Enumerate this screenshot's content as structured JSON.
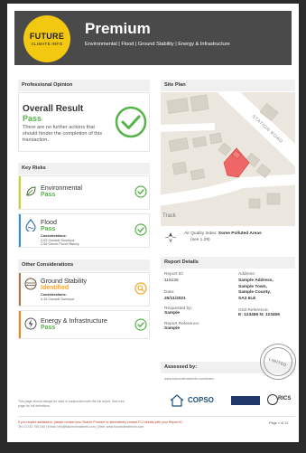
{
  "header": {
    "logo_line1": "FUTURE",
    "logo_line2": "CLIMATE INFO",
    "title": "Premium",
    "subtitle": "Environmental | Flood | Ground Stability | Energy & Infrastructure"
  },
  "professional_opinion": {
    "heading": "Professional Opinion",
    "result_title": "Overall Result",
    "result_value": "Pass",
    "description": "There are no further actions that should hinder the completion of this transaction."
  },
  "key_risks": {
    "heading": "Key Risks",
    "items": [
      {
        "name": "Environmental",
        "value": "Pass"
      },
      {
        "name": "Flood",
        "value": "Pass",
        "considerations_label": "Considerations:",
        "considerations": [
          "2.03 Consult Surveyor",
          "2.06 Check Flood History"
        ]
      }
    ]
  },
  "other_considerations": {
    "heading": "Other Considerations",
    "items": [
      {
        "name": "Ground Stability",
        "value": "Identified",
        "considerations_label": "Considerations:",
        "considerations": [
          "3.15 Consult Surveyor"
        ]
      },
      {
        "name": "Energy & Infrastructure",
        "value": "Pass"
      }
    ]
  },
  "site_plan": {
    "heading": "Site Plan",
    "road_label": "STATION ROAD",
    "track_label": "Track",
    "aqi_label": "Air Quality Index:",
    "aqi_value": "Some Polluted Areas",
    "aqi_sub": "(see 1.29)",
    "compass": "N"
  },
  "report_details": {
    "heading": "Report Details",
    "report_id_label": "Report ID:",
    "report_id": "115125",
    "date_label": "Date:",
    "date": "25/11/2021",
    "requested_label": "Requested by:",
    "requested": "Sample",
    "reference_label": "Report Reference:",
    "reference": "Sample",
    "address_label": "Address:",
    "address": [
      "Sample Address,",
      "Sample Town,",
      "Sample County,",
      "SA3 6LE"
    ],
    "grid_label": "Grid Reference:",
    "grid": "E: 123456 N: 123456"
  },
  "assessed": {
    "label": "Assessed by:",
    "url": "www.futureclimateinfo.com/team",
    "stamp": "LIMITED"
  },
  "footer": {
    "note": "This page should always be read in conjunction with the full report. See next page for full definitions.",
    "partners": [
      "COPSO",
      "RICS"
    ],
    "help": "If you require assistance, please contact your Search Provider or alternatively contact FCI directly with your Report ID.",
    "contact": "Tel: 01732 755 180 | Email: info@futureclimateinfo.com | Web: www.futureclimateinfo.com",
    "page": "Page 1 of 12"
  },
  "colors": {
    "pass": "#55b447",
    "warn": "#f5a623",
    "header_bg": "#4a4a4a",
    "logo": "#f2c811",
    "flood_bar": "#3a8fd1"
  }
}
